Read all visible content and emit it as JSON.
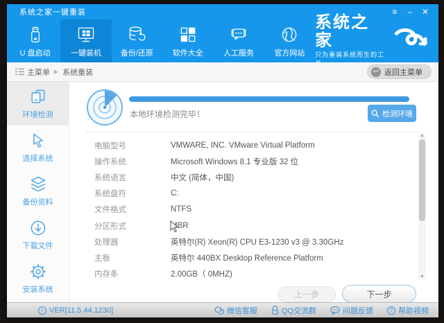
{
  "window": {
    "title": "系统之家一键重装",
    "controls": {
      "menu": "≡",
      "minimize": "–",
      "close": "✕"
    }
  },
  "nav": {
    "items": [
      {
        "label": "U 盘启动"
      },
      {
        "label": "一键装机"
      },
      {
        "label": "备份/还原"
      },
      {
        "label": "软件大全"
      },
      {
        "label": "人工服务"
      },
      {
        "label": "官方网站"
      }
    ],
    "logo": {
      "brand": "系统之家",
      "tagline": "只为重装系统而生的工具"
    }
  },
  "breadcrumb": {
    "root": "主菜单",
    "separator": "▶",
    "current": "系统重装",
    "back_button": "返回主菜单",
    "back_icon": "↩"
  },
  "sidebar": {
    "items": [
      {
        "label": "环境检测"
      },
      {
        "label": "选择系统"
      },
      {
        "label": "备份资料"
      },
      {
        "label": "下载文件"
      },
      {
        "label": "安装系统"
      }
    ]
  },
  "detection": {
    "status_text": "本地环境检测完毕！",
    "progress_percent": 100,
    "button_label": "检测环境"
  },
  "system_info": {
    "rows": [
      {
        "label": "电脑型号",
        "value": "VMWARE, INC. VMware Virtual Platform"
      },
      {
        "label": "操作系统",
        "value": "Microsoft Windows 8.1 专业版 32 位"
      },
      {
        "label": "系统语言",
        "value": "中文 (简体，中国)"
      },
      {
        "label": "系统盘符",
        "value": "C:"
      },
      {
        "label": "文件格式",
        "value": "NTFS"
      },
      {
        "label": "分区形式",
        "value": "MBR"
      },
      {
        "label": "处理器",
        "value": "英特尔(R) Xeon(R) CPU E3-1230 v3 @ 3.30GHz"
      },
      {
        "label": "主板",
        "value": "英特尔 440BX Desktop Reference Platform"
      },
      {
        "label": "内存条",
        "value": "2.00GB（ 0MHZ)"
      }
    ]
  },
  "actions": {
    "prev_label": "上一步",
    "next_label": "下一步"
  },
  "statusbar": {
    "version": "VER[11.5.44.1230]",
    "info_icon": "i",
    "links": [
      {
        "label": "微信客服"
      },
      {
        "label": "QQ交流群"
      },
      {
        "label": "问题反馈"
      },
      {
        "label": "帮助视频"
      }
    ],
    "help_glyph": "?"
  },
  "colors": {
    "header_blue": "#1697ec",
    "active_tab_blue": "#0e86d8",
    "accent_blue": "#4aa3e8",
    "progress_blue": "#3d9ae2"
  }
}
